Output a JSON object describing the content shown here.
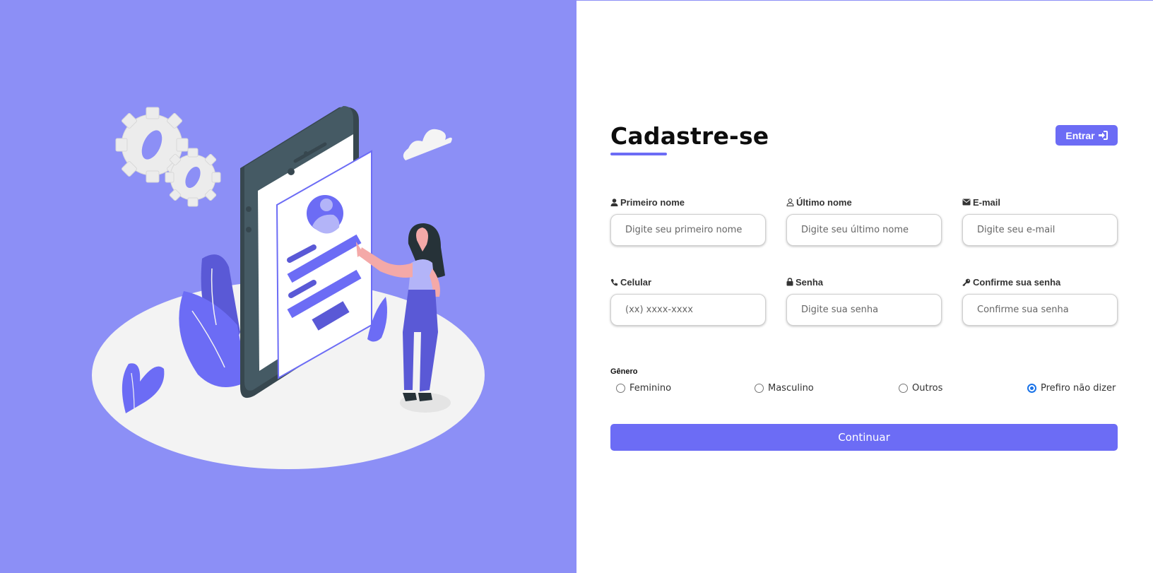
{
  "header": {
    "title": "Cadastre-se",
    "login_label": "Entrar"
  },
  "fields": [
    {
      "label": "Primeiro nome",
      "placeholder": "Digite seu primeiro nome",
      "icon": "user-solid-icon"
    },
    {
      "label": "Último nome",
      "placeholder": "Digite seu último nome",
      "icon": "user-outline-icon"
    },
    {
      "label": "E-mail",
      "placeholder": "Digite seu e-mail",
      "icon": "envelope-icon"
    },
    {
      "label": "Celular",
      "placeholder": "(xx) xxxx-xxxx",
      "icon": "phone-icon"
    },
    {
      "label": "Senha",
      "placeholder": "Digite sua senha",
      "icon": "lock-icon"
    },
    {
      "label": "Confirme sua senha",
      "placeholder": "Confirme sua senha",
      "icon": "key-icon"
    }
  ],
  "gender": {
    "title": "Gênero",
    "options": [
      {
        "label": "Feminino",
        "checked": false
      },
      {
        "label": "Masculino",
        "checked": false
      },
      {
        "label": "Outros",
        "checked": false
      },
      {
        "label": "Prefiro não dizer",
        "checked": true
      }
    ]
  },
  "continue_label": "Continuar",
  "colors": {
    "accent": "#6c6cf5",
    "left_panel_bg": "#8c8ff6",
    "radio_checked": "#1a73e8"
  },
  "illustration": {
    "icons": [
      "gear-icon",
      "cloud-icon",
      "smartphone-icon",
      "profile-avatar-icon",
      "person-illustration",
      "leaf-plant-icon"
    ]
  }
}
